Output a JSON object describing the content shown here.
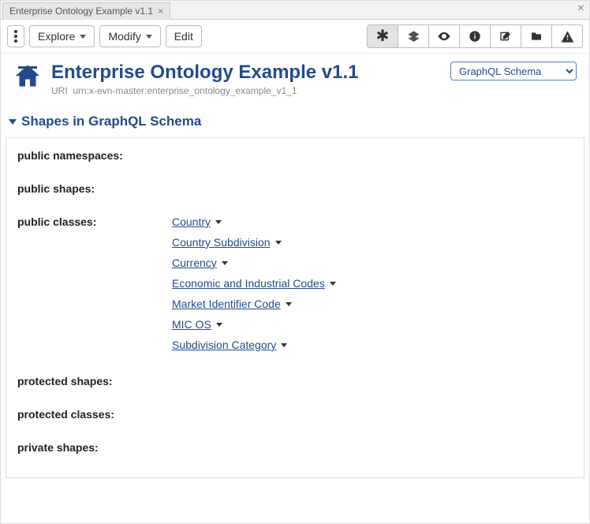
{
  "tab": {
    "title": "Enterprise Ontology Example v1.1"
  },
  "toolbar": {
    "explore": "Explore",
    "modify": "Modify",
    "edit": "Edit"
  },
  "page": {
    "title": "Enterprise Ontology Example v1.1",
    "uriLabel": "URI",
    "uri": "urn:x-evn-master:enterprise_ontology_example_v1_1"
  },
  "schemaDropdown": {
    "selected": "GraphQL Schema"
  },
  "section": {
    "title": "Shapes in GraphQL Schema"
  },
  "fields": {
    "publicNamespaces": "public namespaces:",
    "publicShapes": "public shapes:",
    "publicClasses": "public classes:",
    "protectedShapes": "protected shapes:",
    "protectedClasses": "protected classes:",
    "privateShapes": "private shapes:"
  },
  "publicClasses": [
    "Country",
    "Country Subdivision",
    "Currency",
    "Economic and Industrial Codes",
    "Market Identifier Code",
    "MIC OS",
    "Subdivision Category"
  ]
}
